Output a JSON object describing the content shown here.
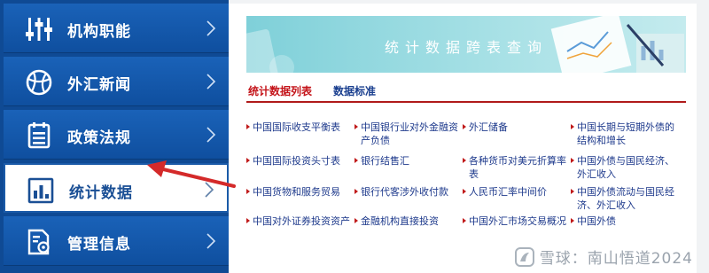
{
  "sidebar": {
    "items": [
      {
        "label": "机构职能",
        "icon": "sliders-icon"
      },
      {
        "label": "外汇新闻",
        "icon": "globe-icon"
      },
      {
        "label": "政策法规",
        "icon": "document-list-icon"
      },
      {
        "label": "统计数据",
        "icon": "bar-chart-icon",
        "active": true
      },
      {
        "label": "管理信息",
        "icon": "settings-document-icon"
      }
    ]
  },
  "main": {
    "banner_title": "统计数据跨表查询",
    "tabs": [
      {
        "label": "统计数据列表",
        "active": true
      },
      {
        "label": "数据标准",
        "active": false
      }
    ],
    "links": [
      [
        "中国国际收支平衡表",
        "中国银行业对外金融资产负债",
        "外汇储备",
        "中国长期与短期外债的结构和增长"
      ],
      [
        "中国国际投资头寸表",
        "银行结售汇",
        "各种货币对美元折算率表",
        "中国外债与国民经济、外汇收入"
      ],
      [
        "中国货物和服务贸易",
        "银行代客涉外收付款",
        "人民币汇率中间价",
        "中国外债流动与国民经济、外汇收入"
      ],
      [
        "中国对外证券投资资产",
        "金融机构直接投资",
        "中国外汇市场交易概况",
        "中国外债"
      ]
    ]
  },
  "watermark": {
    "text": "雪球：南山悟道2024"
  },
  "colors": {
    "sidebar_blue": "#1a62b8",
    "link_blue": "#1e3a8c",
    "accent_red": "#c4141a",
    "banner_teal": "#7fd0d9",
    "arrow_red": "#d42a2a"
  }
}
